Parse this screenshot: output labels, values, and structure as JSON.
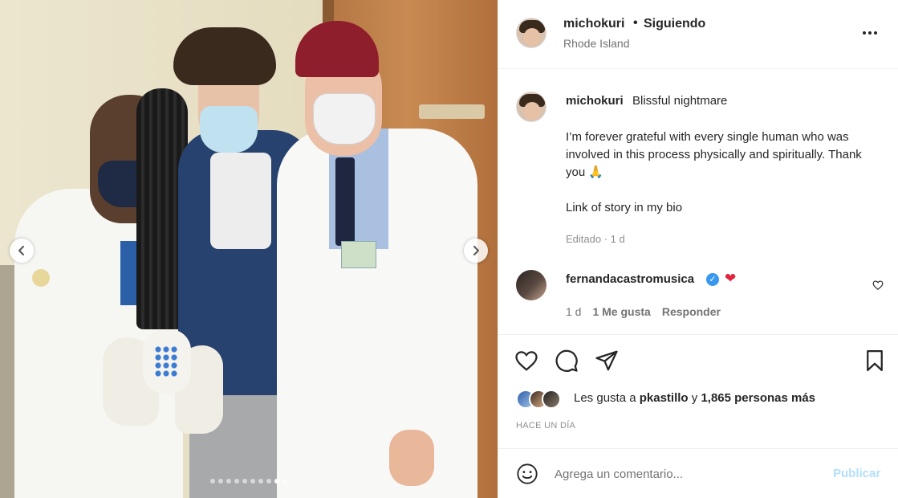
{
  "post": {
    "username": "michokuri",
    "separator": "•",
    "follow_status": "Siguiendo",
    "location": "Rhode Island"
  },
  "caption": {
    "username": "michokuri",
    "title": "Blissful nightmare",
    "body_line1": "I’m forever grateful with every single human who was involved in this process physically and spiritually. Thank you 🙏",
    "body_line2": "Link of story in my bio",
    "meta": "Editado · 1 d"
  },
  "comment": {
    "username": "fernandacastromusica",
    "verified_mark": "✓",
    "heart": "❤",
    "time": "1 d",
    "likes": "1 Me gusta",
    "reply_label": "Responder"
  },
  "likes": {
    "prefix": "Les gusta a",
    "user": "pkastillo",
    "middle": "y",
    "count_text": "1,865 personas más"
  },
  "time_ago": "HACE UN DÍA",
  "add_comment": {
    "placeholder": "Agrega un comentario...",
    "publish_label": "Publicar"
  },
  "carousel": {
    "total": 10,
    "active_index": 8
  },
  "icons": {
    "more": "more-options-icon",
    "like": "heart-outline-icon",
    "comment": "comment-bubble-icon",
    "share": "paper-plane-icon",
    "save": "bookmark-icon",
    "emoji": "emoji-smile-icon",
    "prev": "chevron-left-icon",
    "next": "chevron-right-icon"
  },
  "colors": {
    "publish_disabled": "#b2dffc",
    "verified": "#3897f0",
    "heart_red": "#e0243c"
  }
}
